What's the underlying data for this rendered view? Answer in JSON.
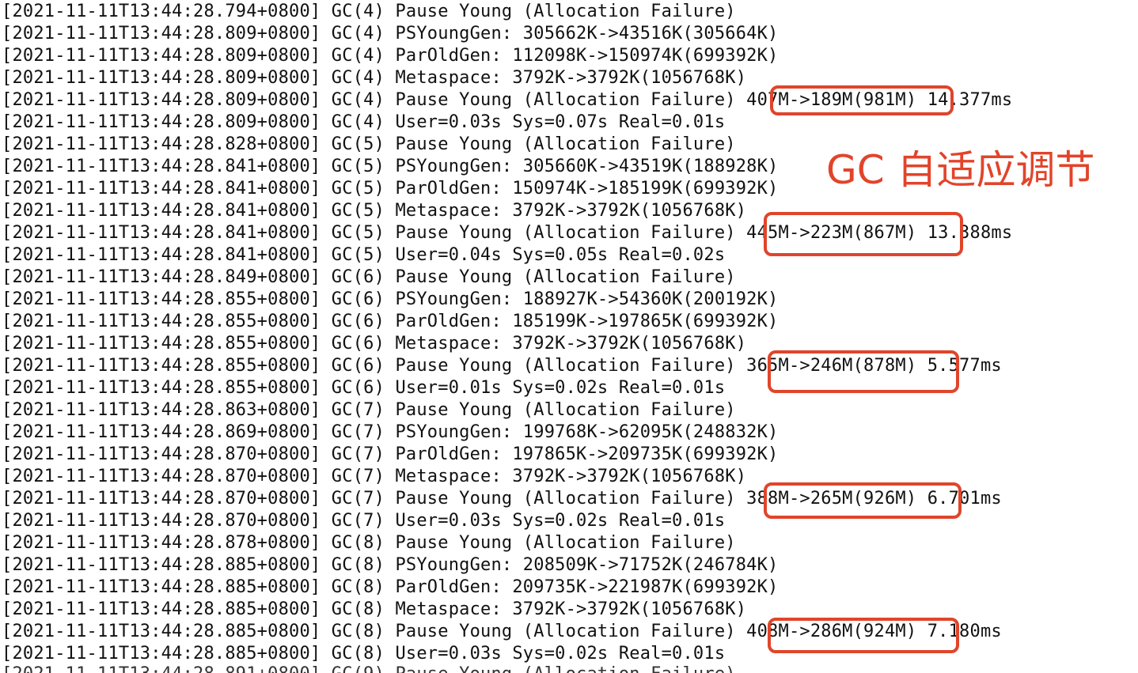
{
  "log_lines": [
    "[2021-11-11T13:44:28.794+0800] GC(4) Pause Young (Allocation Failure)",
    "[2021-11-11T13:44:28.809+0800] GC(4) PSYoungGen: 305662K->43516K(305664K)",
    "[2021-11-11T13:44:28.809+0800] GC(4) ParOldGen: 112098K->150974K(699392K)",
    "[2021-11-11T13:44:28.809+0800] GC(4) Metaspace: 3792K->3792K(1056768K)",
    "[2021-11-11T13:44:28.809+0800] GC(4) Pause Young (Allocation Failure) 407M->189M(981M) 14.377ms",
    "[2021-11-11T13:44:28.809+0800] GC(4) User=0.03s Sys=0.07s Real=0.01s",
    "[2021-11-11T13:44:28.828+0800] GC(5) Pause Young (Allocation Failure)",
    "[2021-11-11T13:44:28.841+0800] GC(5) PSYoungGen: 305660K->43519K(188928K)",
    "[2021-11-11T13:44:28.841+0800] GC(5) ParOldGen: 150974K->185199K(699392K)",
    "[2021-11-11T13:44:28.841+0800] GC(5) Metaspace: 3792K->3792K(1056768K)",
    "[2021-11-11T13:44:28.841+0800] GC(5) Pause Young (Allocation Failure) 445M->223M(867M) 13.388ms",
    "[2021-11-11T13:44:28.841+0800] GC(5) User=0.04s Sys=0.05s Real=0.02s",
    "[2021-11-11T13:44:28.849+0800] GC(6) Pause Young (Allocation Failure)",
    "[2021-11-11T13:44:28.855+0800] GC(6) PSYoungGen: 188927K->54360K(200192K)",
    "[2021-11-11T13:44:28.855+0800] GC(6) ParOldGen: 185199K->197865K(699392K)",
    "[2021-11-11T13:44:28.855+0800] GC(6) Metaspace: 3792K->3792K(1056768K)",
    "[2021-11-11T13:44:28.855+0800] GC(6) Pause Young (Allocation Failure) 365M->246M(878M) 5.577ms",
    "[2021-11-11T13:44:28.855+0800] GC(6) User=0.01s Sys=0.02s Real=0.01s",
    "[2021-11-11T13:44:28.863+0800] GC(7) Pause Young (Allocation Failure)",
    "[2021-11-11T13:44:28.869+0800] GC(7) PSYoungGen: 199768K->62095K(248832K)",
    "[2021-11-11T13:44:28.870+0800] GC(7) ParOldGen: 197865K->209735K(699392K)",
    "[2021-11-11T13:44:28.870+0800] GC(7) Metaspace: 3792K->3792K(1056768K)",
    "[2021-11-11T13:44:28.870+0800] GC(7) Pause Young (Allocation Failure) 388M->265M(926M) 6.701ms",
    "[2021-11-11T13:44:28.870+0800] GC(7) User=0.03s Sys=0.02s Real=0.01s",
    "[2021-11-11T13:44:28.878+0800] GC(8) Pause Young (Allocation Failure)",
    "[2021-11-11T13:44:28.885+0800] GC(8) PSYoungGen: 208509K->71752K(246784K)",
    "[2021-11-11T13:44:28.885+0800] GC(8) ParOldGen: 209735K->221987K(699392K)",
    "[2021-11-11T13:44:28.885+0800] GC(8) Metaspace: 3792K->3792K(1056768K)",
    "[2021-11-11T13:44:28.885+0800] GC(8) Pause Young (Allocation Failure) 408M->286M(924M) 7.180ms",
    "[2021-11-11T13:44:28.885+0800] GC(8) User=0.03s Sys=0.02s Real=0.01s"
  ],
  "partial_last_line": "[2021-11-11T13:44:28.891+0800] GC(9) Pause Young (Allocation Failure)",
  "annotation": {
    "label": "GC 自适应调节",
    "color": "#e2442a"
  },
  "highlight_color": "#e0452b"
}
